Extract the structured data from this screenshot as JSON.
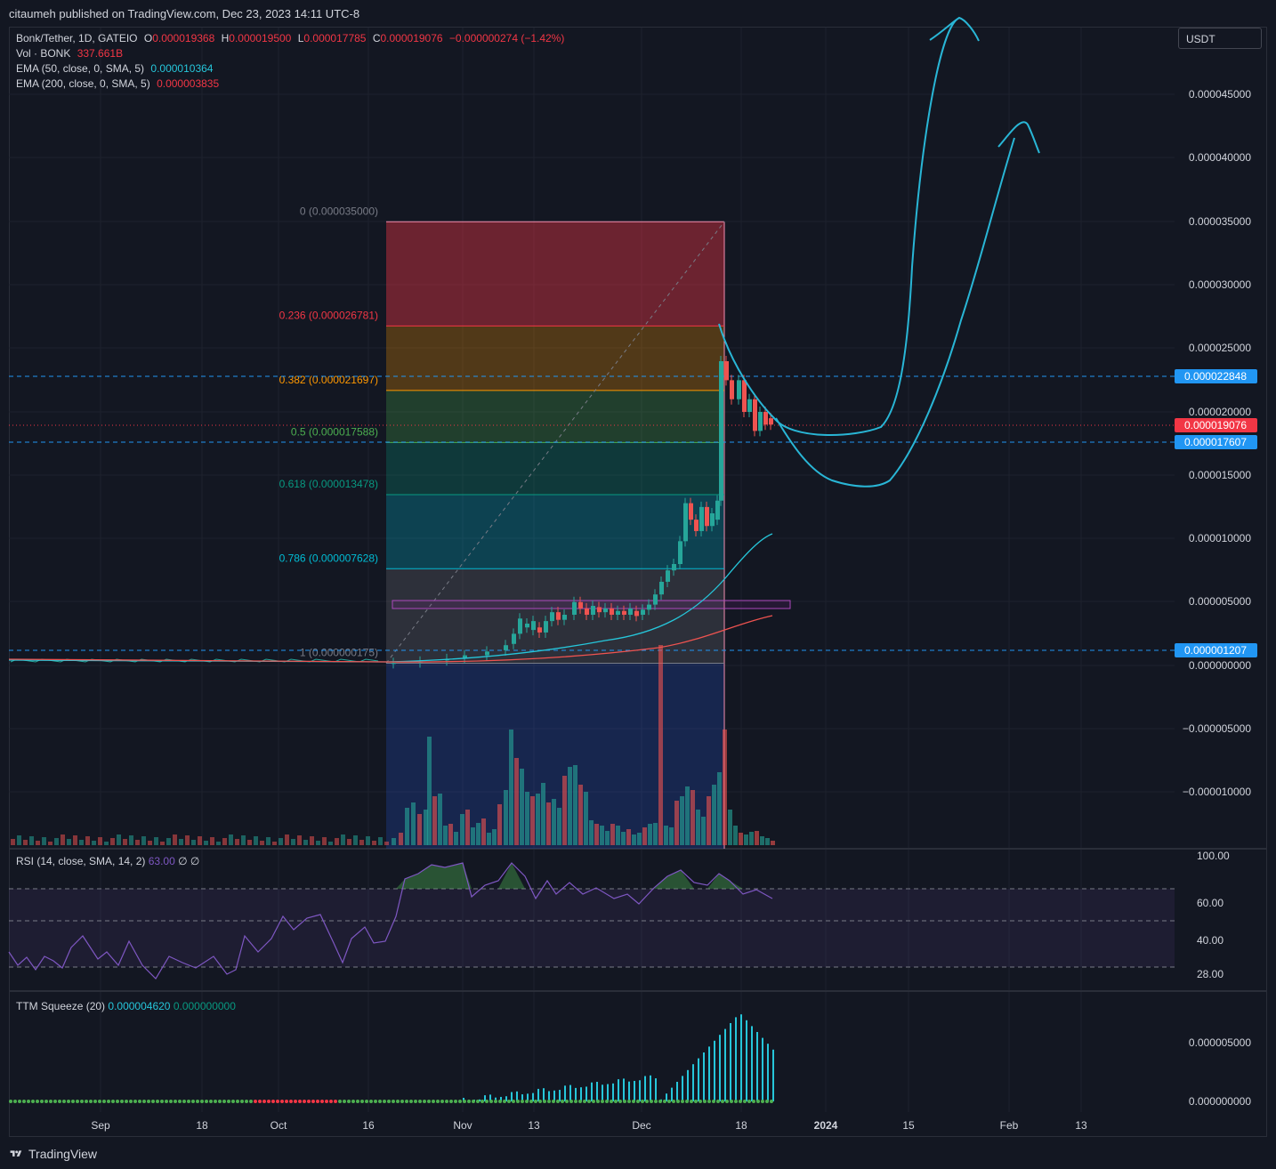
{
  "header": {
    "published": "citaumeh published on TradingView.com, Dec 23, 2023 14:11 UTC-8"
  },
  "symbol": {
    "name": "Bonk/Tether, 1D, GATEIO",
    "o_label": "O",
    "o": "0.000019368",
    "h_label": "H",
    "h": "0.000019500",
    "l_label": "L",
    "l": "0.000017785",
    "c_label": "C",
    "c": "0.000019076",
    "change": "−0.000000274 (−1.42%)"
  },
  "volume": {
    "label": "Vol · BONK",
    "value": "337.661B"
  },
  "ema50": {
    "label": "EMA (50, close, 0, SMA, 5)",
    "value": "0.000010364"
  },
  "ema200": {
    "label": "EMA (200, close, 0, SMA, 5)",
    "value": "0.000003835"
  },
  "currency_button": "USDT",
  "price_axis": [
    "0.000045000",
    "0.000040000",
    "0.000035000",
    "0.000030000",
    "0.000025000",
    "0.000020000",
    "0.000015000",
    "0.000010000",
    "0.000005000",
    "0.000000000",
    "−0.000005000",
    "−0.000010000"
  ],
  "price_tags": [
    {
      "text": "0.000022848",
      "color": "#2196f3"
    },
    {
      "text": "0.000019076",
      "color": "#f23645"
    },
    {
      "text": "0.000017607",
      "color": "#2196f3"
    },
    {
      "text": "0.000001207",
      "color": "#2196f3"
    }
  ],
  "fib_levels": [
    {
      "text": "0 (0.000035000)",
      "color": "#787b86"
    },
    {
      "text": "0.236 (0.000026781)",
      "color": "#f23645"
    },
    {
      "text": "0.382 (0.000021697)",
      "color": "#ff9800"
    },
    {
      "text": "0.5 (0.000017588)",
      "color": "#4caf50"
    },
    {
      "text": "0.618 (0.000013478)",
      "color": "#089981"
    },
    {
      "text": "0.786 (0.000007628)",
      "color": "#00bcd4"
    },
    {
      "text": "1 (0.000000175)",
      "color": "#787b86"
    }
  ],
  "rsi": {
    "label": "RSI (14, close, SMA, 14, 2)",
    "value": "63.00",
    "extra1": "∅",
    "extra2": "∅",
    "axis": [
      "100.00",
      "60.00",
      "40.00",
      "28.00"
    ]
  },
  "squeeze": {
    "label": "TTM Squeeze (20)",
    "value1": "0.000004620",
    "value2": "0.000000000",
    "axis": [
      "0.000005000",
      "0.000000000"
    ]
  },
  "time_axis": [
    "Sep",
    "18",
    "Oct",
    "16",
    "Nov",
    "13",
    "Dec",
    "18",
    "2024",
    "15",
    "Feb",
    "13"
  ],
  "footer": {
    "brand": "TradingView"
  },
  "colors": {
    "up": "#26a69a",
    "down": "#ef5350",
    "ema50": "#26c6da",
    "ema200": "#ef5350",
    "drawing": "#29b6d6",
    "rsi": "#7e57c2",
    "bg": "#131722"
  }
}
